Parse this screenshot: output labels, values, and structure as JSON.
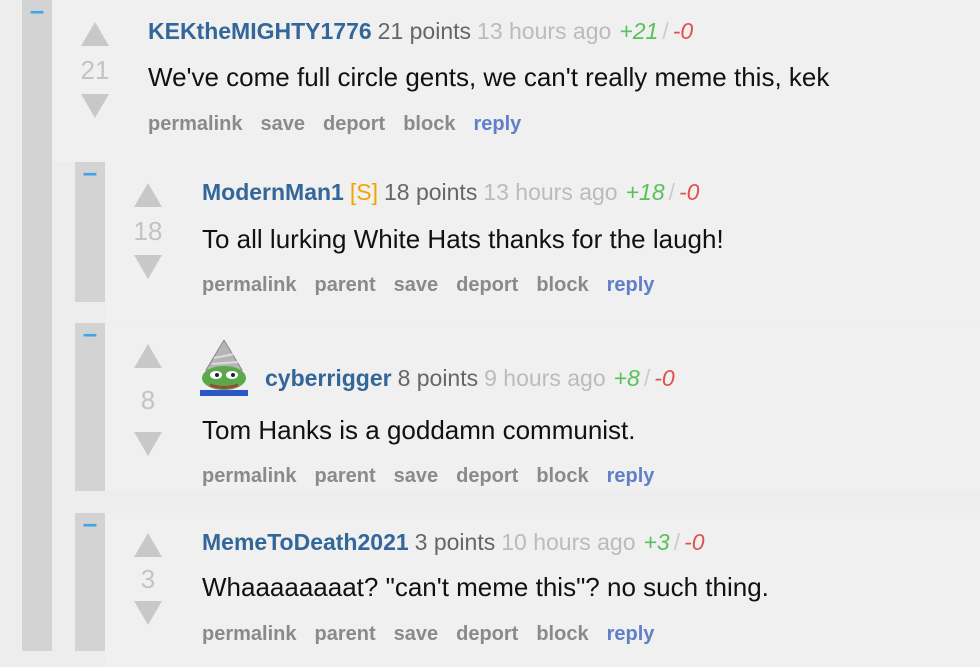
{
  "collapse_symbol": "–",
  "comments": [
    {
      "author": "KEKtheMIGHTY1776",
      "op_tag": "",
      "points": "21 points",
      "time": "13 hours ago",
      "upvotes": "+21",
      "downvotes": "-0",
      "score": "21",
      "body": "We've come full circle gents, we can't really meme this, kek",
      "actions": [
        "permalink",
        "save",
        "deport",
        "block",
        "reply"
      ]
    },
    {
      "author": "ModernMan1",
      "op_tag": "[S]",
      "points": "18 points",
      "time": "13 hours ago",
      "upvotes": "+18",
      "downvotes": "-0",
      "score": "18",
      "body": "To all lurking White Hats thanks for the laugh!",
      "actions": [
        "permalink",
        "parent",
        "save",
        "deport",
        "block",
        "reply"
      ]
    },
    {
      "author": "cyberrigger",
      "op_tag": "",
      "points": "8 points",
      "time": "9 hours ago",
      "upvotes": "+8",
      "downvotes": "-0",
      "score": "8",
      "body": "Tom Hanks is a goddamn communist.",
      "actions": [
        "permalink",
        "parent",
        "save",
        "deport",
        "block",
        "reply"
      ],
      "avatar_icon": "tinfoil-hat-frog-avatar"
    },
    {
      "author": "MemeToDeath2021",
      "op_tag": "",
      "points": "3 points",
      "time": "10 hours ago",
      "upvotes": "+3",
      "downvotes": "-0",
      "score": "3",
      "body": "Whaaaaaaaat? \"can't meme this\"? no such thing.",
      "actions": [
        "permalink",
        "parent",
        "save",
        "deport",
        "block",
        "reply"
      ]
    }
  ],
  "colors": {
    "author": "#336699",
    "op": "#f2a500",
    "upvote": "#5ac05a",
    "downvote": "#e05050",
    "reply": "#5f7fc9",
    "collapse": "#3ea6e8"
  }
}
